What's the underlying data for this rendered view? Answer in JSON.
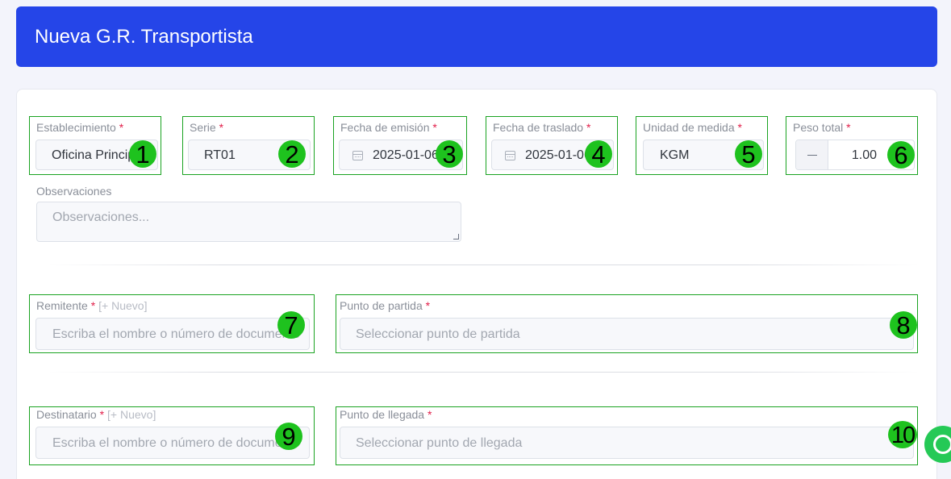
{
  "header": {
    "title": "Nueva G.R. Transportista"
  },
  "form": {
    "establecimiento": {
      "label": "Establecimiento",
      "value": "Oficina Principal",
      "badge": "1"
    },
    "serie": {
      "label": "Serie",
      "value": "RT01",
      "badge": "2"
    },
    "fecha_emision": {
      "label": "Fecha de emisión",
      "value": "2025-01-06",
      "badge": "3"
    },
    "fecha_traslado": {
      "label": "Fecha de traslado",
      "value": "2025-01-06",
      "badge": "4"
    },
    "unidad_medida": {
      "label": "Unidad de medida",
      "value": "KGM",
      "badge": "5"
    },
    "peso_total": {
      "label": "Peso total",
      "value": "1.00",
      "badge": "6"
    },
    "observaciones": {
      "label": "Observaciones",
      "placeholder": "Observaciones..."
    },
    "remitente": {
      "label": "Remitente",
      "new_link": "[+ Nuevo]",
      "placeholder": "Escriba el nombre o número de documento",
      "badge": "7"
    },
    "punto_partida": {
      "label": "Punto de partida",
      "placeholder": "Seleccionar punto de partida",
      "badge": "8"
    },
    "destinatario": {
      "label": "Destinatario",
      "new_link": "[+ Nuevo]",
      "placeholder": "Escriba el nombre o número de documento",
      "badge": "9"
    },
    "punto_llegada": {
      "label": "Punto de llegada",
      "placeholder": "Seleccionar punto de llegada",
      "badge": "10"
    },
    "required_mark": "*"
  },
  "icons": {
    "calendar": "calendar-icon",
    "minus": "minus-icon",
    "whatsapp": "whatsapp-icon"
  },
  "colors": {
    "header_bg": "#2545e8",
    "required": "#e11d48",
    "highlight": "#1aa321",
    "badge": "#1ec21e",
    "whatsapp": "#25c956"
  }
}
